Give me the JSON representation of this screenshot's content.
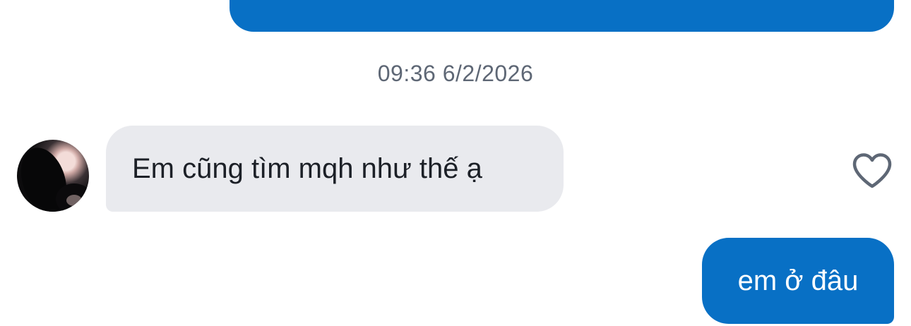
{
  "conversation": {
    "previous_message": {
      "text": "",
      "sender": "me"
    },
    "timestamp": "09:36 6/2/2026",
    "incoming_message": {
      "text": "Em cũng tìm mqh như thế ạ",
      "sender": "contact"
    },
    "outgoing_message": {
      "text": "em ở đâu",
      "sender": "me"
    }
  },
  "icons": {
    "like": "heart-outline-icon",
    "avatar": "profile-photo"
  },
  "colors": {
    "outgoing_bubble": "#0870c5",
    "incoming_bubble": "#e9eaee",
    "timestamp_text": "#5e6775",
    "heart_stroke": "#5e6775"
  }
}
